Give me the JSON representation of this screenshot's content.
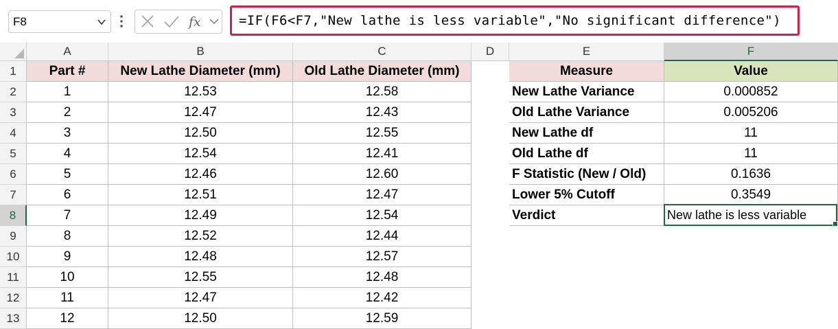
{
  "formula_bar": {
    "name_box": "F8",
    "formula": "=IF(F6<F7,\"New lathe is less variable\",\"No significant difference\")",
    "fx_label": "fx"
  },
  "accent_color": "#1d6b3c",
  "highlight_color": "#d21f4b",
  "columns": [
    "A",
    "B",
    "C",
    "D",
    "E",
    "F"
  ],
  "rows": [
    "1",
    "2",
    "3",
    "4",
    "5",
    "6",
    "7",
    "8",
    "9",
    "10",
    "11",
    "12",
    "13"
  ],
  "left_table": {
    "headers": [
      "Part #",
      "New Lathe Diameter (mm)",
      "Old Lathe Diameter (mm)"
    ],
    "data": [
      [
        "1",
        "12.53",
        "12.58"
      ],
      [
        "2",
        "12.47",
        "12.43"
      ],
      [
        "3",
        "12.50",
        "12.55"
      ],
      [
        "4",
        "12.54",
        "12.41"
      ],
      [
        "5",
        "12.46",
        "12.60"
      ],
      [
        "6",
        "12.51",
        "12.47"
      ],
      [
        "7",
        "12.49",
        "12.54"
      ],
      [
        "8",
        "12.52",
        "12.44"
      ],
      [
        "9",
        "12.48",
        "12.57"
      ],
      [
        "10",
        "12.55",
        "12.48"
      ],
      [
        "11",
        "12.47",
        "12.42"
      ],
      [
        "12",
        "12.50",
        "12.59"
      ]
    ]
  },
  "right_table": {
    "headers": [
      "Measure",
      "Value"
    ],
    "data": [
      [
        "New Lathe Variance",
        "0.000852"
      ],
      [
        "Old Lathe Variance",
        "0.005206"
      ],
      [
        "New Lathe df",
        "11"
      ],
      [
        "Old Lathe df",
        "11"
      ],
      [
        "F Statistic (New / Old)",
        "0.1636"
      ],
      [
        "Lower 5% Cutoff",
        "0.3549"
      ],
      [
        "Verdict",
        "New lathe is less variable"
      ]
    ]
  },
  "selected_cell": "F8",
  "selected_column": "F",
  "selected_row": "8"
}
